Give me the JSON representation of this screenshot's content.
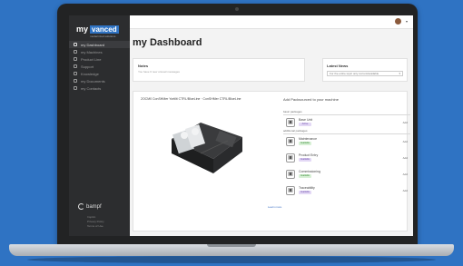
{
  "brand": {
    "logo_prefix": "my",
    "logo_word": "vanced",
    "logo_tagline": "modernized solutions",
    "footer_brand": "bampf",
    "footer_links": [
      "Imprint",
      "Privacy Policy",
      "Terms of Use"
    ]
  },
  "sidebar": {
    "items": [
      {
        "label": "my Dashboard",
        "icon": "grid-icon"
      },
      {
        "label": "my Machines",
        "icon": "wrench-icon"
      },
      {
        "label": "Product Line",
        "icon": "box-icon"
      },
      {
        "label": "Support",
        "icon": "person-icon"
      },
      {
        "label": "Knowledge",
        "icon": "book-icon"
      },
      {
        "label": "my Documents",
        "icon": "folder-icon"
      },
      {
        "label": "my Contacts",
        "icon": "contact-icon"
      }
    ]
  },
  "main": {
    "title": "my Dashboard",
    "notes": {
      "title": "Notes",
      "subtitle": "You have 0 new unread messages"
    },
    "news": {
      "title": "Latest News",
      "select_value": "For the entire topic only current/available"
    },
    "machine_title": "2OCM0 ConSHMer Yortilit CTRL/BlueLine · ConSHMer CTRL/BlueLine",
    "add_title": "Add Packsourced to your machine",
    "section_basic": "basic packages",
    "section_additional": "additional packages",
    "packages": [
      {
        "name": "Base Unit",
        "tag": "Active",
        "tag_bg": "#e3d8f5",
        "tag_fg": "#6a4aa8"
      },
      {
        "name": "Maintenance",
        "tag": "Available",
        "tag_bg": "#d7f0d5",
        "tag_fg": "#3a8a37"
      },
      {
        "name": "Product Entry",
        "tag": "Available",
        "tag_bg": "#e3d8f5",
        "tag_fg": "#6a4aa8"
      },
      {
        "name": "Commissioning",
        "tag": "Available",
        "tag_bg": "#d7f0d5",
        "tag_fg": "#3a8a37"
      },
      {
        "name": "Traceability",
        "tag": "Available",
        "tag_bg": "#e3d8f5",
        "tag_fg": "#6a4aa8"
      }
    ],
    "more_link": "Learn more",
    "button_label": "Add"
  },
  "colors": {
    "background": "#2f73c3",
    "sidebar": "#2c2d2f",
    "accent": "#3b6fc4"
  }
}
